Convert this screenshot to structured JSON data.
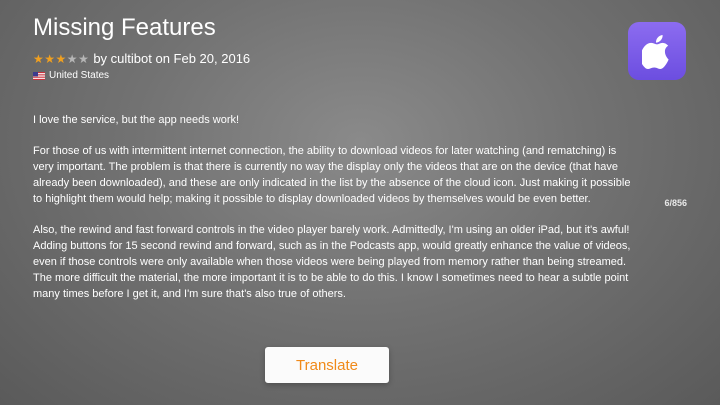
{
  "review": {
    "title": "Missing Features",
    "rating": 3,
    "max_rating": 5,
    "byline": "by cultibot on Feb 20, 2016",
    "country": "United States",
    "paragraphs": [
      "I love the service, but the app needs work!",
      "For those of us with intermittent internet connection, the ability to download videos for later watching (and rematching) is very important.  The problem is that there is currently no way the display only the videos that are on the device (that have already been downloaded), and these are only indicated in the list by the absence of the cloud icon.  Just making it possible to highlight them would help; making it possible to display downloaded videos by themselves would be even better.",
      "Also, the rewind and fast forward controls in the video player barely work.  Admittedly, I'm using an older iPad, but it's awful!  Adding buttons for 15 second rewind and forward, such as in the Podcasts app, would greatly enhance the value of videos, even if those controls were only available when those videos were being played from memory rather than being streamed.  The more difficult the material, the more important it is to be able to do this.  I know I sometimes need to hear a subtle point many times before I get it, and I'm sure that's also true of others."
    ]
  },
  "app": {
    "icon": "apple-logo-icon",
    "icon_color": "#7a5ce8"
  },
  "pagination": {
    "counter": "6/856"
  },
  "actions": {
    "translate_label": "Translate"
  },
  "colors": {
    "star_on": "#f0a020",
    "star_off": "#b5b5b5",
    "accent": "#f08a1a"
  }
}
